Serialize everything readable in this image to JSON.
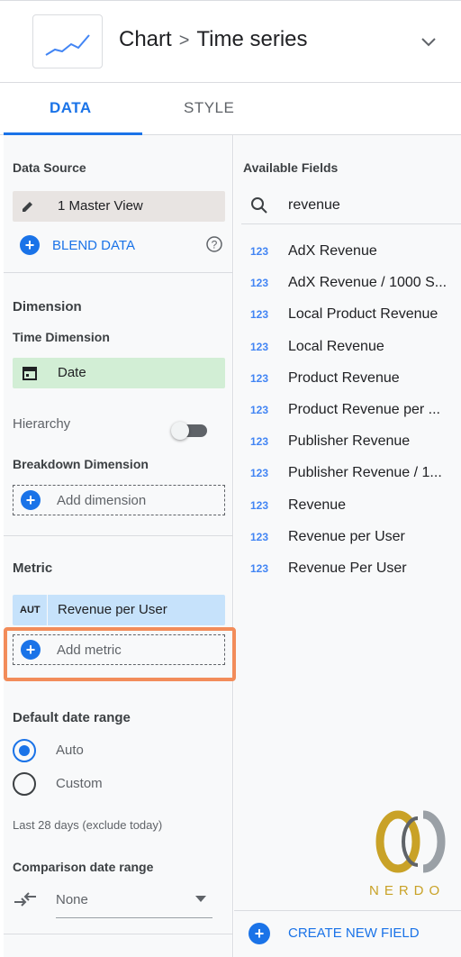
{
  "header": {
    "breadcrumb_root": "Chart",
    "breadcrumb_separator": ">",
    "breadcrumb_current": "Time series"
  },
  "tabs": [
    {
      "label": "DATA",
      "active": true
    },
    {
      "label": "STYLE",
      "active": false
    }
  ],
  "left": {
    "data_source_label": "Data Source",
    "data_source_value": "1 Master View",
    "blend_data_label": "BLEND DATA",
    "dimension_label": "Dimension",
    "time_dimension_label": "Time Dimension",
    "time_dimension_value": "Date",
    "hierarchy_label": "Hierarchy",
    "breakdown_label": "Breakdown Dimension",
    "add_dimension_label": "Add dimension",
    "metric_label": "Metric",
    "metric_badge": "AUT",
    "metric_value": "Revenue per User",
    "add_metric_label": "Add metric",
    "default_date_range_label": "Default date range",
    "radio_auto": "Auto",
    "radio_custom": "Custom",
    "date_range_note": "Last 28 days (exclude today)",
    "comparison_label": "Comparison date range",
    "comparison_value": "None"
  },
  "right": {
    "available_fields_label": "Available Fields",
    "search_value": "revenue",
    "field_type_badge": "123",
    "fields": [
      "AdX Revenue",
      "AdX Revenue / 1000 S...",
      "Local Product Revenue",
      "Local Revenue",
      "Product Revenue",
      "Product Revenue per ...",
      "Publisher Revenue",
      "Publisher Revenue / 1...",
      "Revenue",
      "Revenue per User",
      "Revenue Per User"
    ],
    "create_field_label": "CREATE NEW FIELD"
  },
  "watermark": {
    "text": "NERDO"
  },
  "colors": {
    "accent": "#1a73e8",
    "highlight": "#f28c5a",
    "dimension_chip": "#d2eed5",
    "metric_chip": "#c6e2fb"
  },
  "icons": {
    "chart": "time-series-chart-icon",
    "chevron": "chevron-down-icon",
    "edit": "pencil-icon",
    "blend": "plus-circle-icon",
    "help": "help-circle-icon",
    "calendar": "calendar-icon",
    "search": "search-icon",
    "compare": "compare-arrows-icon",
    "dropdown": "caret-down-icon"
  }
}
